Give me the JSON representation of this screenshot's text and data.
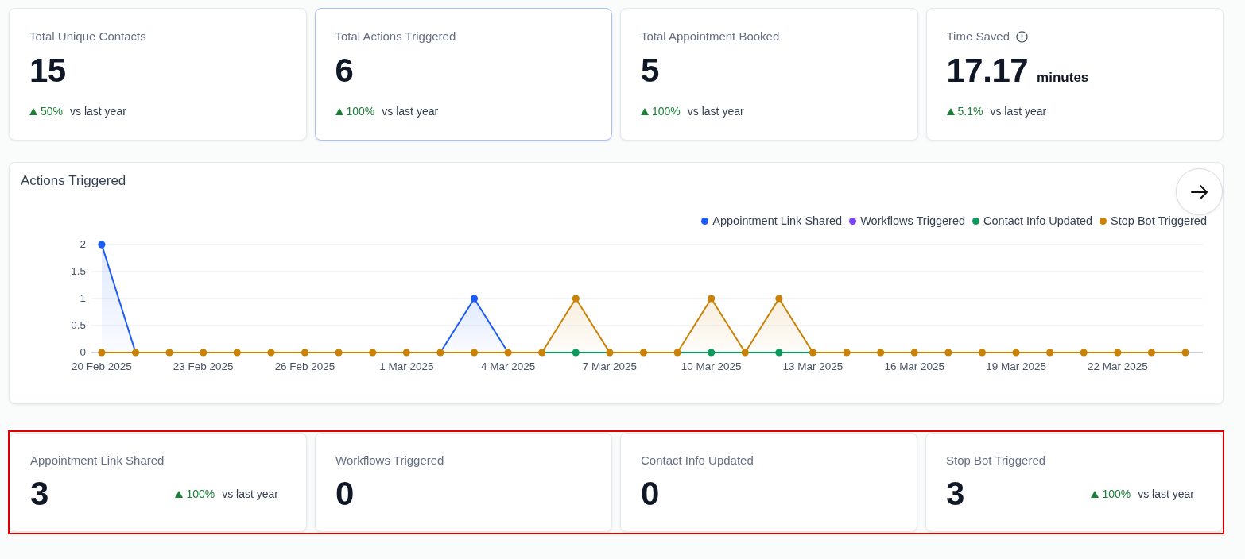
{
  "summary_cards": [
    {
      "label": "Total Unique Contacts",
      "value": "15",
      "change": {
        "increase": true,
        "percent": "50%",
        "comparison": "vs last year"
      },
      "selected": false
    },
    {
      "label": "Total Actions Triggered",
      "value": "6",
      "change": {
        "increase": true,
        "percent": "100%",
        "comparison": "vs last year"
      },
      "selected": true
    },
    {
      "label": "Total Appointment Booked",
      "value": "5",
      "change": {
        "increase": true,
        "percent": "100%",
        "comparison": "vs last year"
      },
      "selected": false
    },
    {
      "label": "Time Saved",
      "info_icon": true,
      "value": "17.17",
      "unit": "minutes",
      "change": {
        "increase": true,
        "percent": "5.1%",
        "comparison": "vs last year"
      },
      "selected": false
    }
  ],
  "actions_chart": {
    "chart_data": {
      "type": "line",
      "title": "Actions Triggered",
      "grid": true,
      "categories": [
        "20 Feb 2025",
        null,
        null,
        "23 Feb 2025",
        null,
        null,
        "26 Feb 2025",
        null,
        null,
        "1 Mar 2025",
        null,
        null,
        "4 Mar 2025",
        null,
        null,
        "7 Mar 2025",
        null,
        null,
        "10 Mar 2025",
        null,
        null,
        "13 Mar 2025",
        null,
        null,
        "16 Mar 2025",
        null,
        null,
        "19 Mar 2025",
        null,
        null,
        "22 Mar 2025",
        null,
        null
      ],
      "ylim": [
        0,
        2
      ],
      "yticks": [
        0,
        0.5,
        1,
        1.5,
        2
      ],
      "series": [
        {
          "name": "Appointment Link Shared",
          "color": "#1a5cf5",
          "marker": true,
          "values": [
            2,
            0,
            null,
            null,
            null,
            null,
            null,
            null,
            null,
            null,
            0,
            1,
            0,
            null,
            null,
            null,
            null,
            null,
            null,
            null,
            null,
            null,
            null,
            null,
            null,
            null,
            null,
            null,
            null,
            null,
            null,
            null,
            null
          ]
        },
        {
          "name": "Workflows Triggered",
          "color": "#7a44f0",
          "marker": true,
          "values": [
            null,
            null,
            null,
            null,
            null,
            null,
            null,
            null,
            null,
            null,
            null,
            null,
            null,
            null,
            null,
            null,
            null,
            null,
            null,
            null,
            null,
            null,
            null,
            null,
            null,
            null,
            null,
            null,
            null,
            null,
            null,
            null,
            null
          ]
        },
        {
          "name": "Contact Info Updated",
          "color": "#0a9a5c",
          "marker": true,
          "values": [
            null,
            null,
            null,
            null,
            null,
            null,
            null,
            null,
            null,
            null,
            null,
            null,
            null,
            0,
            0,
            0,
            null,
            0,
            0,
            0,
            0,
            0,
            null,
            null,
            null,
            null,
            null,
            null,
            null,
            null,
            null,
            null,
            null
          ]
        },
        {
          "name": "Stop Bot Triggered",
          "color": "#c98206",
          "marker": true,
          "values": [
            0,
            0,
            0,
            0,
            0,
            0,
            0,
            0,
            0,
            0,
            0,
            0,
            0,
            0,
            1,
            0,
            0,
            0,
            1,
            0,
            1,
            0,
            0,
            0,
            0,
            0,
            0,
            0,
            0,
            0,
            0,
            0,
            0
          ]
        }
      ]
    }
  },
  "action_summary": {
    "highlighted": true,
    "cards": [
      {
        "label": "Appointment Link Shared",
        "value": "3",
        "change": {
          "increase": true,
          "percent": "100%",
          "comparison": "vs last year"
        }
      },
      {
        "label": "Workflows Triggered",
        "value": "0"
      },
      {
        "label": "Contact Info Updated",
        "value": "0"
      },
      {
        "label": "Stop Bot Triggered",
        "value": "3",
        "change": {
          "increase": true,
          "percent": "100%",
          "comparison": "vs last year"
        }
      }
    ]
  }
}
